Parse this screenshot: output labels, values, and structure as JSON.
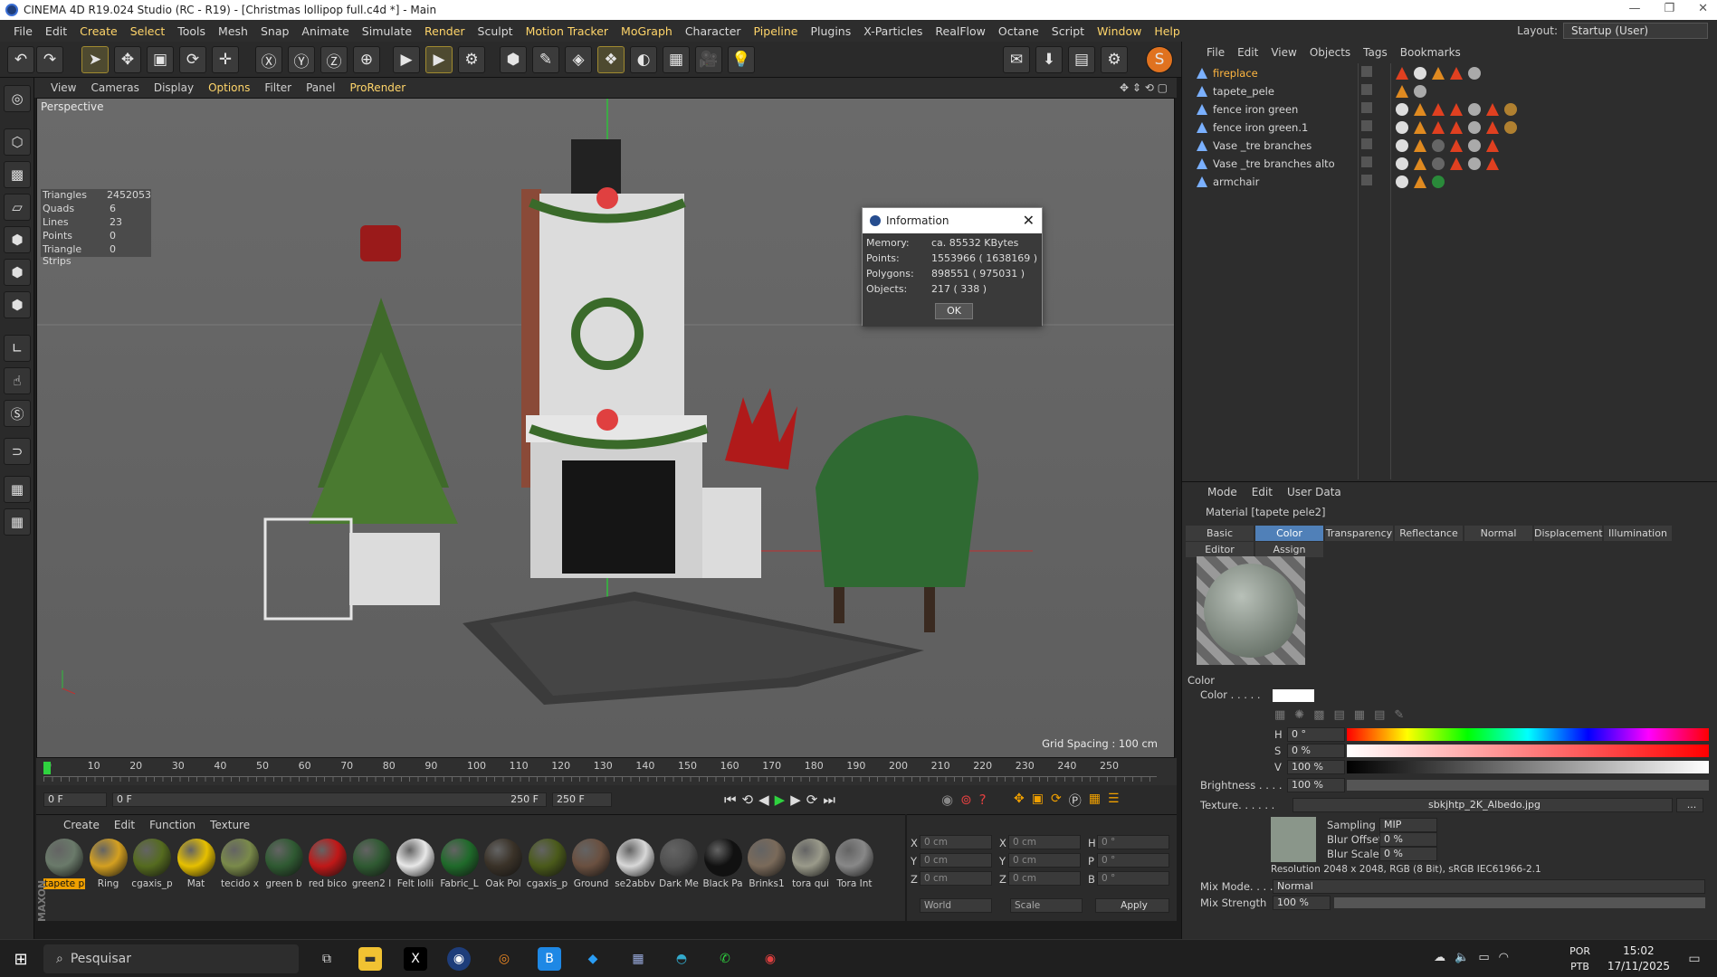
{
  "window": {
    "title": "CINEMA 4D R19.024 Studio (RC - R19) - [Christmas lollipop full.c4d *] - Main"
  },
  "menu": [
    "File",
    "Edit",
    "Create",
    "Select",
    "Tools",
    "Mesh",
    "Snap",
    "Animate",
    "Simulate",
    "Render",
    "Sculpt",
    "Motion Tracker",
    "MoGraph",
    "Character",
    "Pipeline",
    "Plugins",
    "X-Particles",
    "RealFlow",
    "Octane",
    "Script",
    "Window",
    "Help"
  ],
  "layout": {
    "label": "Layout:",
    "value": "Startup (User)"
  },
  "view_menu": [
    "View",
    "Cameras",
    "Display",
    "Options",
    "Filter",
    "Panel",
    "ProRender"
  ],
  "viewport": {
    "label": "Perspective",
    "grid_spacing": "Grid Spacing : 100 cm",
    "stats": [
      [
        "Triangles",
        "2452053"
      ],
      [
        "Quads",
        "6"
      ],
      [
        "Lines",
        "23"
      ],
      [
        "Points",
        "0"
      ],
      [
        "Triangle Strips",
        "0"
      ]
    ]
  },
  "info_dialog": {
    "title": "Information",
    "rows": [
      [
        "Memory:",
        "ca. 85532 KBytes"
      ],
      [
        "Points:",
        "1553966 ( 1638169 )"
      ],
      [
        "Polygons:",
        "898551 ( 975031 )"
      ],
      [
        "Objects:",
        "217 ( 338 )"
      ]
    ],
    "ok": "OK"
  },
  "timeline": {
    "ticks": [
      "0",
      "10",
      "20",
      "30",
      "40",
      "50",
      "60",
      "70",
      "80",
      "90",
      "100",
      "110",
      "120",
      "130",
      "140",
      "150",
      "160",
      "170",
      "180",
      "190",
      "200",
      "210",
      "220",
      "230",
      "240",
      "250"
    ],
    "current": "0 F",
    "start": "0 F",
    "range_end": "250 F",
    "end": "250 F",
    "frame_field": "0 F"
  },
  "material_menu": [
    "Create",
    "Edit",
    "Function",
    "Texture"
  ],
  "materials": [
    "tapete p",
    "Ring",
    "cgaxis_p",
    "Mat",
    "tecido x",
    "green b",
    "red bico",
    "green2 l",
    "Felt lolli",
    "Fabric_L",
    "Oak Pol",
    "cgaxis_p",
    "Ground",
    "se2abbv",
    "Dark Me",
    "Black Pa",
    "Brinks1",
    "tora qui",
    "Tora Int"
  ],
  "coords": {
    "rows": [
      [
        "X",
        "0 cm",
        "X",
        "0 cm",
        "H",
        "0 °"
      ],
      [
        "Y",
        "0 cm",
        "Y",
        "0 cm",
        "P",
        "0 °"
      ],
      [
        "Z",
        "0 cm",
        "Z",
        "0 cm",
        "B",
        "0 °"
      ]
    ],
    "mode1": "World",
    "mode2": "Scale",
    "apply": "Apply"
  },
  "object_menu": [
    "File",
    "Edit",
    "View",
    "Objects",
    "Tags",
    "Bookmarks"
  ],
  "objects": [
    "fireplace",
    "tapete_pele",
    "fence iron green",
    "fence iron green.1",
    "Vase _tre branches",
    "Vase _tre branches alto",
    "armchair"
  ],
  "attr_menu": [
    "Mode",
    "Edit",
    "User Data"
  ],
  "material_title": "Material [tapete pele2]",
  "tabs": [
    "Basic",
    "Color",
    "Transparency",
    "Reflectance",
    "Normal",
    "Displacement",
    "Illumination"
  ],
  "tabs2": [
    "Editor",
    "Assign"
  ],
  "color_section": {
    "header": "Color",
    "color_label": "Color . . . . .",
    "H": "0 °",
    "S": "0 %",
    "V": "100 %",
    "brightness_label": "Brightness . . . .",
    "brightness": "100 %",
    "texture_label": "Texture. . . . . .",
    "texture": "sbkjhtp_2K_Albedo.jpg",
    "sampling_label": "Sampling",
    "sampling": "MIP",
    "blur_offset_label": "Blur Offset",
    "blur_offset": "0 %",
    "blur_scale_label": "Blur Scale",
    "blur_scale": "0 %",
    "resolution": "Resolution 2048 x 2048, RGB (8 Bit), sRGB IEC61966-2.1",
    "mix_mode_label": "Mix Mode. . . . .",
    "mix_mode": "Normal",
    "mix_strength_label": "Mix Strength",
    "mix_strength": "100 %"
  },
  "taskbar": {
    "search": "Pesquisar",
    "lang1": "POR",
    "lang2": "PTB",
    "time": "15:02",
    "date": "17/11/2025"
  }
}
